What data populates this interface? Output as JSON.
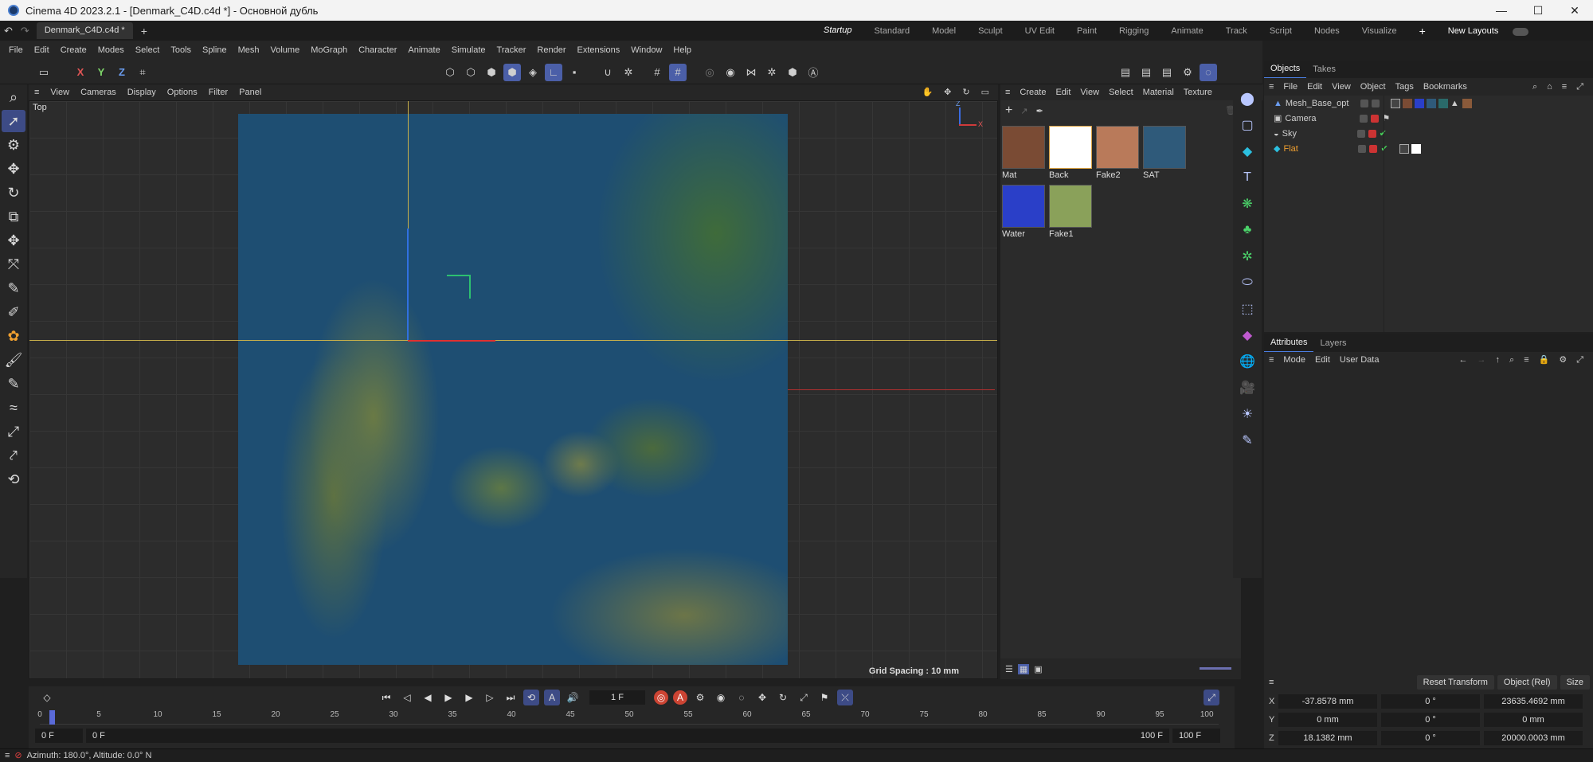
{
  "window": {
    "title": "Cinema 4D 2023.2.1 - [Denmark_C4D.c4d *] - Основной дубль"
  },
  "tabs": {
    "document": "Denmark_C4D.c4d *",
    "add": "+"
  },
  "layouts": {
    "items": [
      "Startup",
      "Standard",
      "Model",
      "Sculpt",
      "UV Edit",
      "Paint",
      "Rigging",
      "Animate",
      "Track",
      "Script",
      "Nodes",
      "Visualize"
    ],
    "add": "+",
    "new_layouts": "New Layouts"
  },
  "menu": [
    "File",
    "Edit",
    "Create",
    "Modes",
    "Select",
    "Tools",
    "Spline",
    "Mesh",
    "Volume",
    "MoGraph",
    "Character",
    "Animate",
    "Simulate",
    "Tracker",
    "Render",
    "Extensions",
    "Window",
    "Help"
  ],
  "axis_buttons": {
    "x": "X",
    "y": "Y",
    "z": "Z"
  },
  "viewport": {
    "menu": [
      "View",
      "Cameras",
      "Display",
      "Options",
      "Filter",
      "Panel"
    ],
    "label": "Top",
    "grid_spacing": "Grid Spacing : 10 mm",
    "gizmo": {
      "z": "Z",
      "x": "X"
    }
  },
  "materials": {
    "menu": [
      "Create",
      "Edit",
      "View",
      "Select",
      "Material",
      "Texture"
    ],
    "items": [
      {
        "name": "Mat",
        "color": "#7a4b34"
      },
      {
        "name": "Back",
        "color": "#ffffff"
      },
      {
        "name": "Fake2",
        "color": "#b97a5a"
      },
      {
        "name": "SAT",
        "color": "#2f5a7a"
      },
      {
        "name": "Water",
        "color": "#2a3fc8"
      },
      {
        "name": "Fake1",
        "color": "#8aa15a"
      }
    ]
  },
  "objects": {
    "tabs": [
      "Objects",
      "Takes"
    ],
    "menu": [
      "File",
      "Edit",
      "View",
      "Object",
      "Tags",
      "Bookmarks"
    ],
    "rows": [
      {
        "name": "Mesh_Base_opt",
        "color": "#cfcfcf"
      },
      {
        "name": "Camera",
        "color": "#cfcfcf"
      },
      {
        "name": "Sky",
        "color": "#cfcfcf"
      },
      {
        "name": "Flat",
        "color": "#f0a030"
      }
    ]
  },
  "attributes": {
    "tabs": [
      "Attributes",
      "Layers"
    ],
    "menu": [
      "Mode",
      "Edit",
      "User Data"
    ]
  },
  "coordinates": {
    "reset": "Reset Transform",
    "mode": "Object (Rel)",
    "size_mode": "Size",
    "rows": [
      {
        "axis": "X",
        "pos": "-37.8578 mm",
        "rot": "0 °",
        "size": "23635.4692 mm"
      },
      {
        "axis": "Y",
        "pos": "0 mm",
        "rot": "0 °",
        "size": "0 mm"
      },
      {
        "axis": "Z",
        "pos": "18.1382 mm",
        "rot": "0 °",
        "size": "20000.0003 mm"
      }
    ]
  },
  "timeline": {
    "current_frame": "1 F",
    "ticks": [
      "0",
      "5",
      "10",
      "15",
      "20",
      "25",
      "30",
      "35",
      "40",
      "45",
      "50",
      "55",
      "60",
      "65",
      "70",
      "75",
      "80",
      "85",
      "90",
      "95",
      "100"
    ],
    "start": "0 F",
    "min": "0 F",
    "max": "100 F",
    "end": "100 F"
  },
  "status": {
    "text": "Azimuth: 180.0°, Altitude: 0.0°  N"
  }
}
